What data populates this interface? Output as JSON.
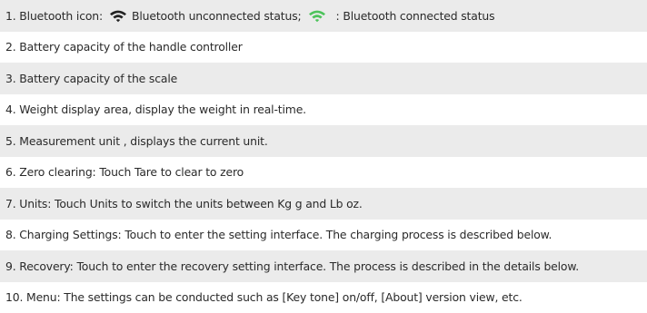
{
  "items": [
    {
      "text_a": "1. Bluetooth icon:",
      "icon_a": "wifi-icon",
      "icon_a_color": "#222222",
      "text_b": "Bluetooth unconnected status;",
      "icon_b": "wifi-icon",
      "icon_b_color": "#4cc35a",
      "text_c": ": Bluetooth connected status"
    },
    {
      "text": "2. Battery capacity of the handle controller"
    },
    {
      "text": "3. Battery capacity of the scale"
    },
    {
      "text": "4. Weight display area, display the weight in real-time."
    },
    {
      "text": "5. Measurement unit , displays the current unit."
    },
    {
      "text": "6. Zero clearing: Touch Tare to clear to zero"
    },
    {
      "text": "7. Units: Touch Units to switch the units between Kg g and Lb oz."
    },
    {
      "text": "8. Charging Settings: Touch to enter the setting interface. The charging process is described below."
    },
    {
      "text": "9. Recovery: Touch to enter the recovery setting interface. The process is described in the details below."
    },
    {
      "text": "10. Menu: The settings can be conducted such as [Key tone] on/off, [About] version view, etc."
    }
  ],
  "colors": {
    "row_shaded": "#ebebeb",
    "row_plain": "#ffffff",
    "text": "#2a2a2a"
  }
}
